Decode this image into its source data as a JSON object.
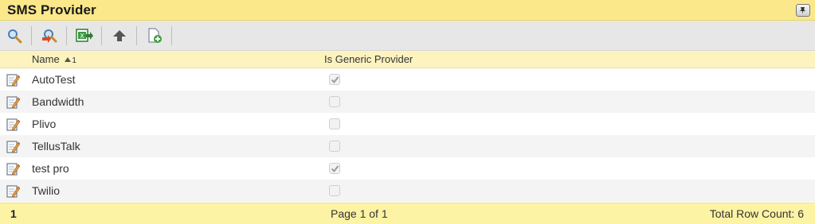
{
  "window": {
    "title": "SMS Provider"
  },
  "toolbar": {
    "buttons": [
      {
        "icon": "search-icon"
      },
      {
        "icon": "clear-search-icon"
      },
      {
        "icon": "export-excel-icon"
      },
      {
        "icon": "upload-icon"
      },
      {
        "icon": "new-record-icon"
      }
    ]
  },
  "grid": {
    "columns": {
      "name": "Name",
      "sort_indicator": "1",
      "generic": "Is Generic Provider"
    },
    "rows": [
      {
        "name": "AutoTest",
        "generic": true
      },
      {
        "name": "Bandwidth",
        "generic": false
      },
      {
        "name": "Plivo",
        "generic": false
      },
      {
        "name": "TellusTalk",
        "generic": false
      },
      {
        "name": "test pro",
        "generic": true
      },
      {
        "name": "Twilio",
        "generic": false
      }
    ]
  },
  "footer": {
    "page_number": "1",
    "page_info": "Page 1 of 1",
    "row_count": "Total Row Count: 6"
  },
  "colors": {
    "title_bar": "#fbe88a",
    "header": "#fdf3bf",
    "footer": "#fdf3a4"
  }
}
